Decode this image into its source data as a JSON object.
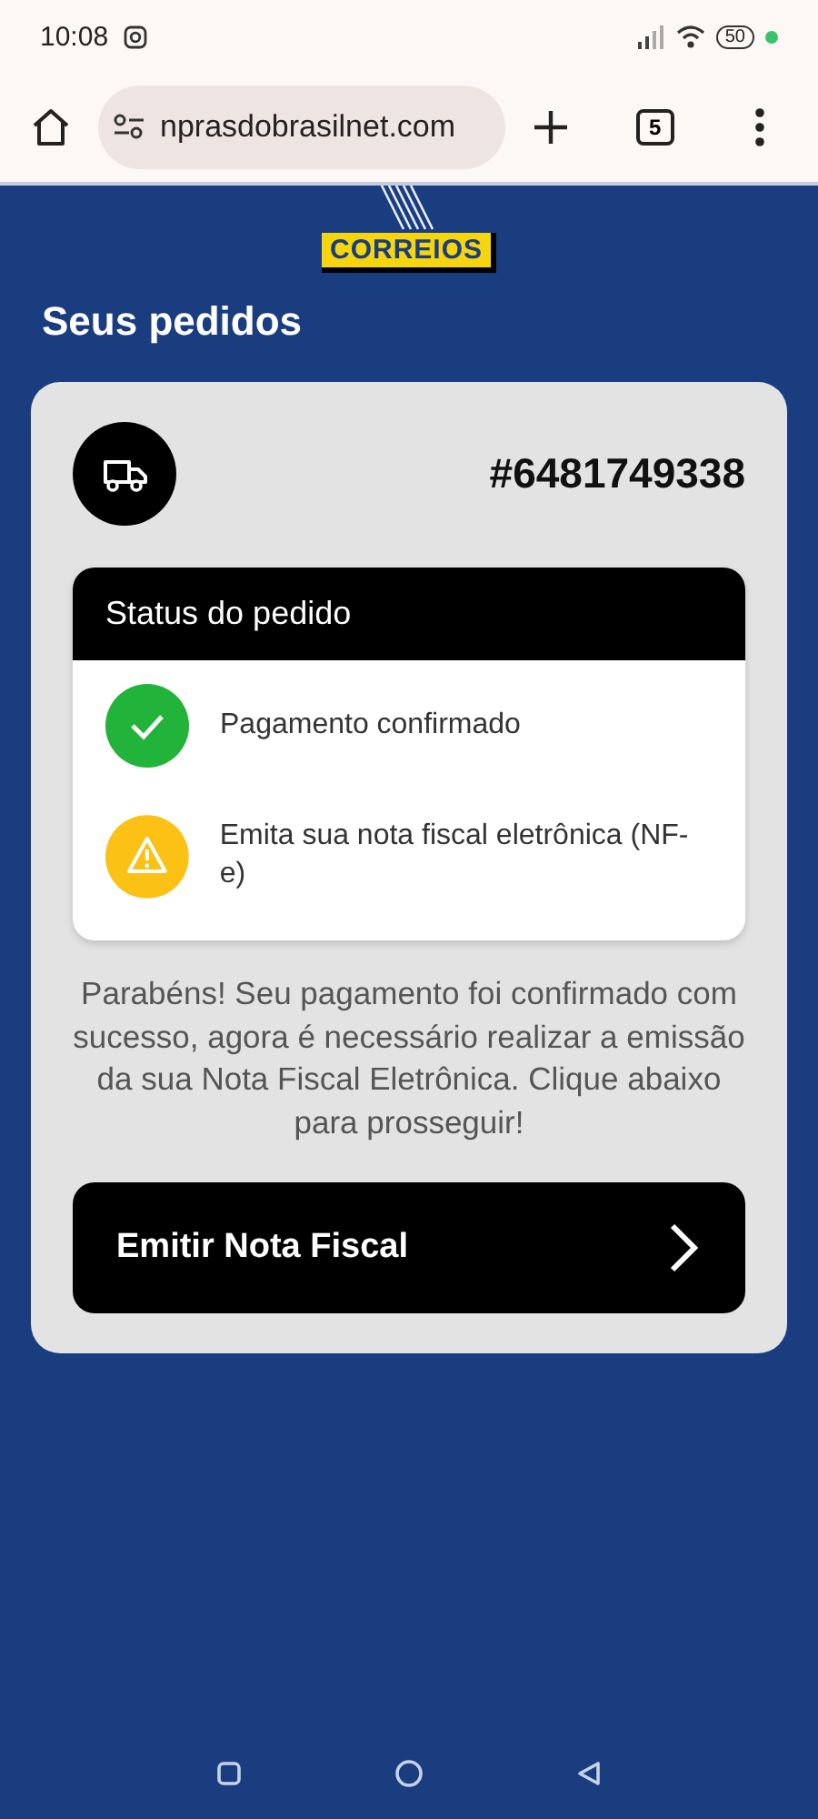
{
  "status_bar": {
    "time": "10:08",
    "battery": "50"
  },
  "browser": {
    "url": "nprasdobrasilnet.com",
    "tab_count": "5"
  },
  "logo": {
    "text": "CORREIOS"
  },
  "page_title": "Seus pedidos",
  "order": {
    "number": "#6481749338"
  },
  "status_panel": {
    "title": "Status do pedido",
    "steps": [
      {
        "kind": "done",
        "label": "Pagamento confirmado"
      },
      {
        "kind": "warning",
        "label": "Emita sua nota fiscal eletrônica (NF-e)"
      }
    ]
  },
  "message": "Parabéns! Seu pagamento foi confirmado com sucesso, agora é necessário realizar a emissão da sua Nota Fiscal Eletrônica. Clique abaixo para prosseguir!",
  "action_button": {
    "label": "Emitir Nota Fiscal"
  }
}
